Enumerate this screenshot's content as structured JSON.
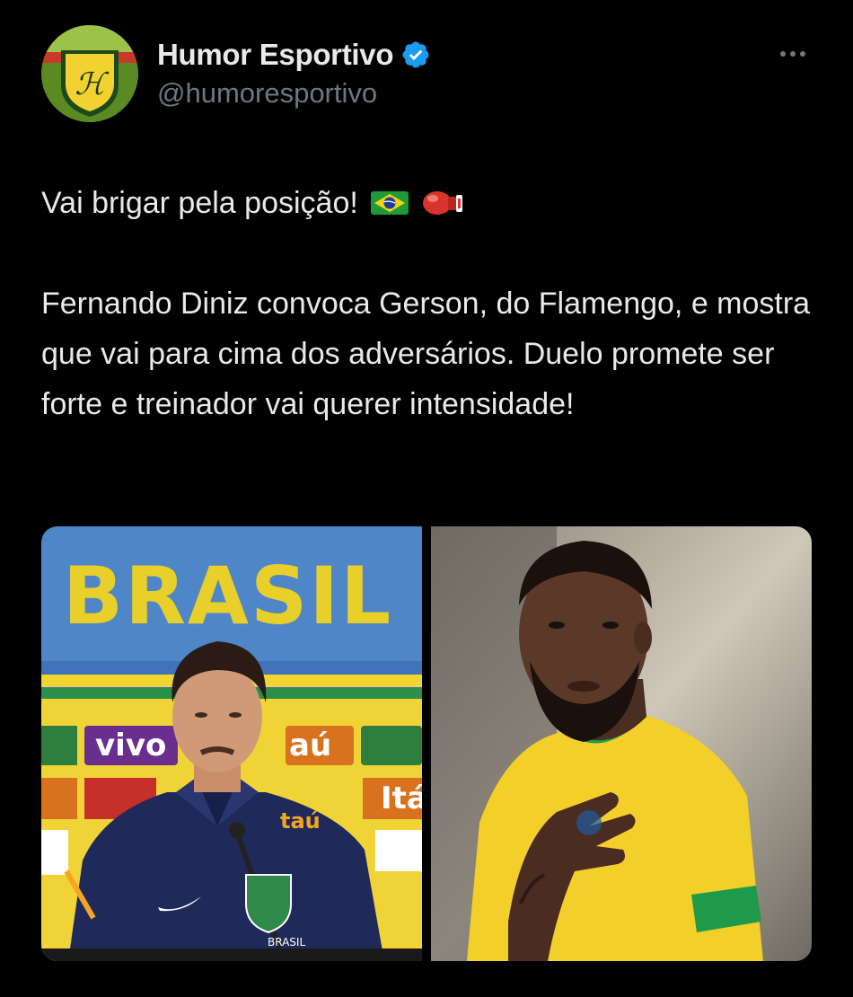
{
  "author": {
    "display_name": "Humor Esportivo",
    "handle": "@humoresportivo",
    "avatar_icon": "humor-esportivo-logo",
    "verified": true
  },
  "actions": {
    "more_icon": "ellipsis-icon"
  },
  "tweet": {
    "line1": "Vai brigar pela posição!",
    "emojis": [
      "flag-brazil",
      "boxing-glove"
    ],
    "para2": "Fernando Diniz convoca Gerson, do Flamengo, e mostra que vai para cima dos adversários. Duelo promete ser forte e treinador vai querer intensidade!"
  },
  "media": {
    "photo_left": {
      "backdrop_text": "BRASIL",
      "sponsor_1": "vivo",
      "sponsor_2": "aú",
      "sponsor_3": "Itá",
      "shirt_text": "taú",
      "crest_text": "BRASIL"
    }
  },
  "colors": {
    "background": "#000000",
    "text": "#e7e9ea",
    "secondary": "#71767b",
    "verified_blue": "#1d9bf0",
    "brasil_yellow": "#e8cf2a"
  }
}
